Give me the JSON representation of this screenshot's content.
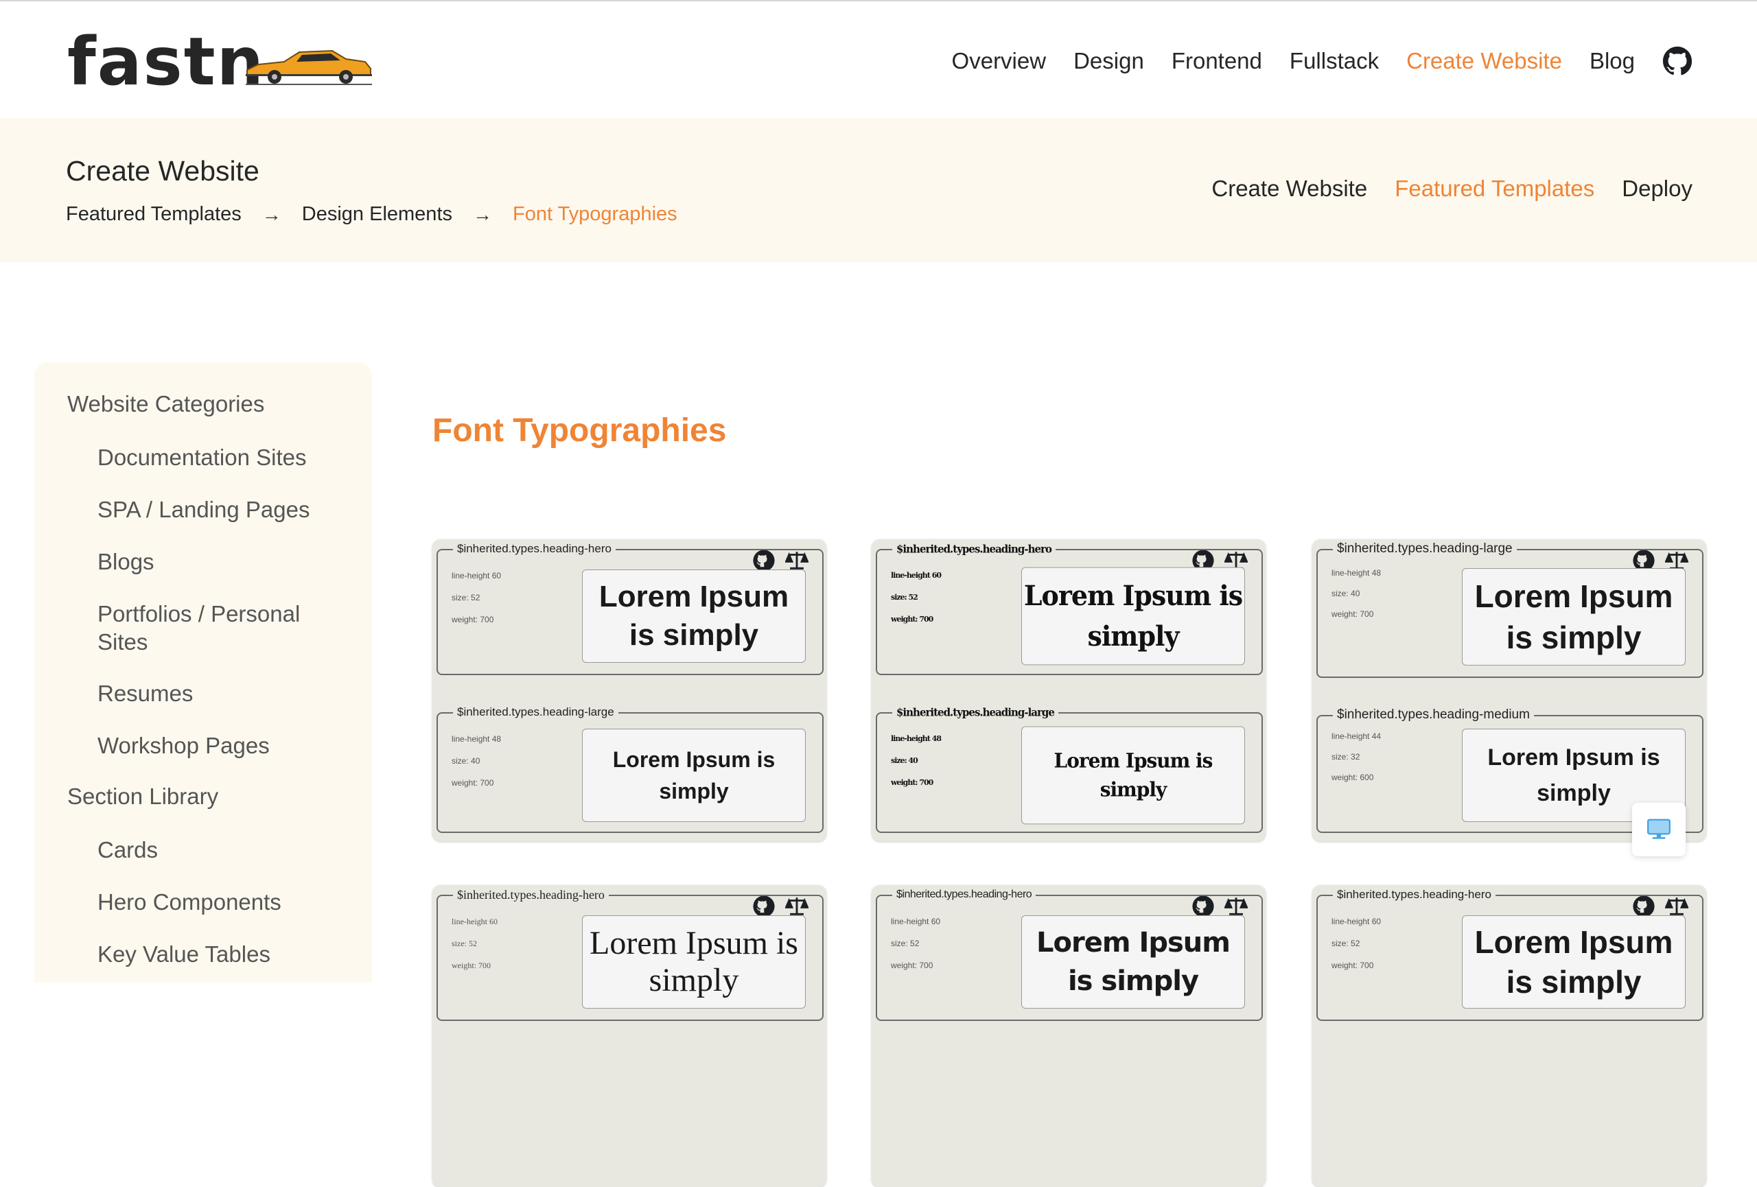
{
  "header": {
    "logo": "fastn",
    "nav": [
      "Overview",
      "Design",
      "Frontend",
      "Fullstack",
      "Create Website",
      "Blog"
    ],
    "active_nav": "Create Website"
  },
  "subheader": {
    "title": "Create Website",
    "breadcrumbs": [
      "Featured Templates",
      "Design Elements",
      "Font Typographies"
    ],
    "subnav": [
      "Create Website",
      "Featured Templates",
      "Deploy"
    ],
    "active_subnav": "Featured Templates"
  },
  "sidebar": {
    "website_categories": "Website Categories",
    "website_items": [
      "Documentation Sites",
      "SPA / Landing Pages",
      "Blogs",
      "Portfolios / Personal Sites",
      "Resumes",
      "Workshop Pages"
    ],
    "section_library": "Section Library",
    "section_items": [
      "Cards",
      "Hero Components",
      "Key Value Tables"
    ]
  },
  "main": {
    "heading": "Font Typographies",
    "meta_labels": {
      "line_height": "line-height",
      "size": "size:",
      "weight": "weight:"
    },
    "preview_text": "Lorem Ipsum is simply",
    "cards": [
      {
        "panels": [
          {
            "title": "$inherited.types.heading-hero",
            "line_height": "60",
            "size": "52",
            "weight": "700"
          },
          {
            "title": "$inherited.types.heading-large",
            "line_height": "48",
            "size": "40",
            "weight": "700"
          }
        ]
      },
      {
        "panels": [
          {
            "title": "$inherited.types.heading-hero",
            "line_height": "60",
            "size": "52",
            "weight": "700"
          },
          {
            "title": "$inherited.types.heading-large",
            "line_height": "48",
            "size": "40",
            "weight": "700"
          }
        ]
      },
      {
        "panels": [
          {
            "title": "$inherited.types.heading-large",
            "line_height": "48",
            "size": "40",
            "weight": "700"
          },
          {
            "title": "$inherited.types.heading-medium",
            "line_height": "44",
            "size": "32",
            "weight": "600"
          }
        ]
      },
      {
        "panels": [
          {
            "title": "$inherited.types.heading-hero",
            "line_height": "60",
            "size": "52",
            "weight": "700"
          }
        ]
      },
      {
        "panels": [
          {
            "title": "$inherited.types.heading-hero",
            "line_height": "60",
            "size": "52",
            "weight": "700"
          }
        ]
      },
      {
        "panels": [
          {
            "title": "$inherited.types.heading-hero",
            "line_height": "60",
            "size": "52",
            "weight": "700"
          }
        ]
      }
    ]
  },
  "colors": {
    "accent": "#ef8435",
    "cream": "#fdf9ef",
    "card_bg": "#e8e8e1"
  },
  "icons": [
    "github-icon",
    "scale-icon",
    "desktop-icon",
    "arrow-right-icon",
    "car-logo-icon"
  ]
}
